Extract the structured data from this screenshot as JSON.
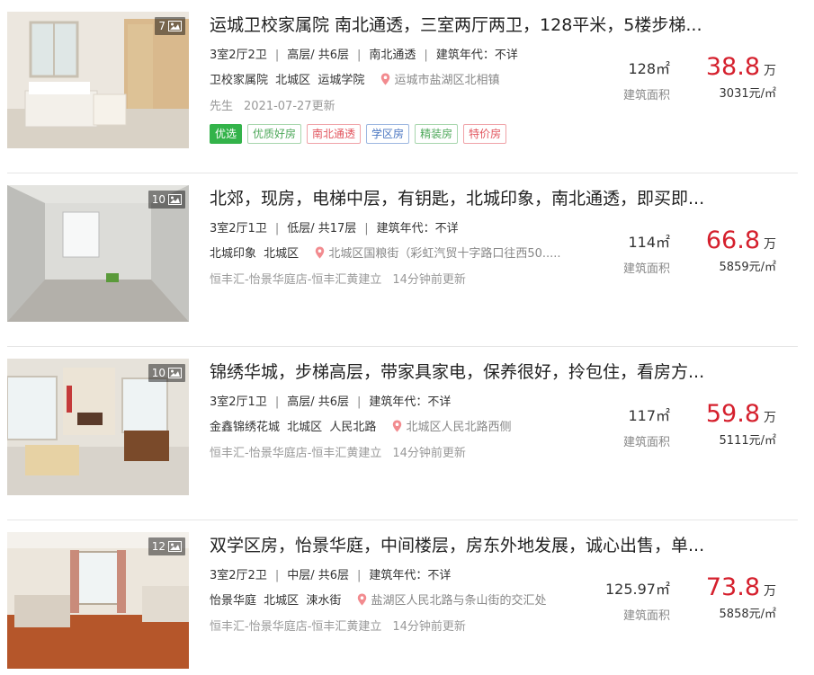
{
  "listings": [
    {
      "photo_count": "7",
      "title": "运城卫校家属院 南北通透，三室两厅两卫，128平米，5楼步梯...",
      "layout": "3室2厅2卫",
      "floor": "高层/ 共6层",
      "orientation": "南北通透",
      "build_year": "建筑年代：不详",
      "community": "卫校家属院",
      "district": "北城区",
      "area_name": "运城学院",
      "address": "运城市盐湖区北相镇",
      "agent": "先生",
      "updated": "2021-07-27更新",
      "tags": [
        "优选",
        "优质好房",
        "南北通透",
        "学区房",
        "精装房",
        "特价房"
      ],
      "size": "128㎡",
      "size_label": "建筑面积",
      "price": "38.8",
      "price_unit": "万",
      "unit_price": "3031元/㎡"
    },
    {
      "photo_count": "10",
      "title": "北郊，现房，电梯中层，有钥匙，北城印象，南北通透，即买即...",
      "layout": "3室2厅1卫",
      "floor": "低层/ 共17层",
      "build_year": "建筑年代：不详",
      "community": "北城印象",
      "district": "北城区",
      "address": "北城区国粮街（彩虹汽贸十字路口往西50.....",
      "agent": "恒丰汇-怡景华庭店-恒丰汇黄建立",
      "updated": "14分钟前更新",
      "size": "114㎡",
      "size_label": "建筑面积",
      "price": "66.8",
      "price_unit": "万",
      "unit_price": "5859元/㎡"
    },
    {
      "photo_count": "10",
      "title": "锦绣华城，步梯高层，带家具家电，保养很好，拎包住，看房方...",
      "layout": "3室2厅1卫",
      "floor": "高层/ 共6层",
      "build_year": "建筑年代：不详",
      "community": "金鑫锦绣花城",
      "district": "北城区",
      "area_name": "人民北路",
      "address": "北城区人民北路西侧",
      "agent": "恒丰汇-怡景华庭店-恒丰汇黄建立",
      "updated": "14分钟前更新",
      "size": "117㎡",
      "size_label": "建筑面积",
      "price": "59.8",
      "price_unit": "万",
      "unit_price": "5111元/㎡"
    },
    {
      "photo_count": "12",
      "title": "双学区房，怡景华庭，中间楼层，房东外地发展，诚心出售，单...",
      "layout": "3室2厅2卫",
      "floor": "中层/ 共6层",
      "build_year": "建筑年代：不详",
      "community": "怡景华庭",
      "district": "北城区",
      "area_name": "涑水街",
      "address": "盐湖区人民北路与条山街的交汇处",
      "agent": "恒丰汇-怡景华庭店-恒丰汇黄建立",
      "updated": "14分钟前更新",
      "size": "125.97㎡",
      "size_label": "建筑面积",
      "price": "73.8",
      "price_unit": "万",
      "unit_price": "5858元/㎡"
    }
  ],
  "icons": {
    "photo": "picture-icon",
    "location": "map-pin-icon"
  },
  "colors": {
    "price": "#d5202d",
    "pin": "#f28b8f",
    "tag_youxuan_bg": "#33b34a"
  }
}
